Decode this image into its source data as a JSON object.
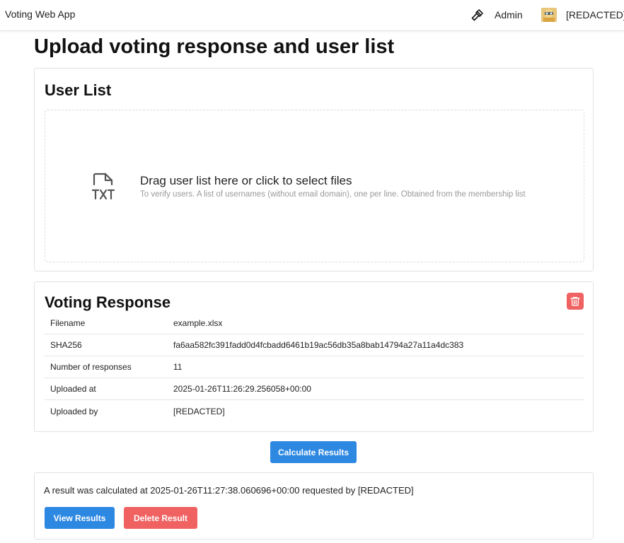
{
  "header": {
    "app_title": "Voting Web App",
    "admin_label": "Admin",
    "user_name": "[REDACTED]",
    "admin_icon": "gavel-icon",
    "avatar_icon": "avatar"
  },
  "page": {
    "title": "Upload voting response and user list"
  },
  "user_list": {
    "title": "User List",
    "dropzone_icon": "txt-file-icon",
    "dropzone_label": "Drag user list here or click to select files",
    "dropzone_hint": "To verify users. A list of usernames (without email domain), one per line. Obtained from the membership list"
  },
  "voting_response": {
    "title": "Voting Response",
    "delete_icon": "trash-icon",
    "rows": [
      {
        "key": "Filename",
        "value": "example.xlsx"
      },
      {
        "key": "SHA256",
        "value": "fa6aa582fc391fadd0d4fcbadd6461b19ac56db35a8bab14794a27a11a4dc383"
      },
      {
        "key": "Number of responses",
        "value": "11"
      },
      {
        "key": "Uploaded at",
        "value": "2025-01-26T11:26:29.256058+00:00"
      },
      {
        "key": "Uploaded by",
        "value": "[REDACTED]"
      }
    ]
  },
  "actions": {
    "calculate_label": "Calculate Results"
  },
  "result": {
    "message": "A result was calculated at 2025-01-26T11:27:38.060696+00:00 requested by [REDACTED]",
    "view_label": "View Results",
    "delete_label": "Delete Result"
  },
  "colors": {
    "primary": "#2d88e2",
    "danger": "#f06262"
  }
}
